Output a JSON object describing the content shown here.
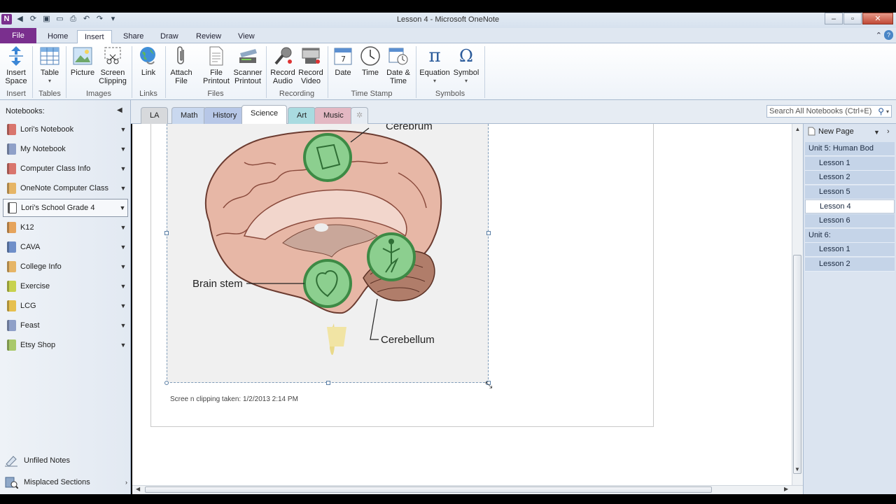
{
  "window": {
    "title": "Lesson 4  -  Microsoft OneNote"
  },
  "ribbon_tabs": [
    {
      "label": "File"
    },
    {
      "label": "Home"
    },
    {
      "label": "Insert"
    },
    {
      "label": "Share"
    },
    {
      "label": "Draw"
    },
    {
      "label": "Review"
    },
    {
      "label": "View"
    }
  ],
  "ribbon_buttons": {
    "insert_space": "Insert Space",
    "table": "Table",
    "picture": "Picture",
    "screen_clipping": "Screen Clipping",
    "link": "Link",
    "attach_file": "Attach File",
    "file_printout": "File Printout",
    "scanner_printout": "Scanner Printout",
    "record_audio": "Record Audio",
    "record_video": "Record Video",
    "date": "Date",
    "time": "Time",
    "date_time": "Date & Time",
    "equation": "Equation",
    "symbol": "Symbol"
  },
  "ribbon_groups": {
    "insert": "Insert",
    "tables": "Tables",
    "images": "Images",
    "links": "Links",
    "files": "Files",
    "recording": "Recording",
    "time_stamp": "Time Stamp",
    "symbols": "Symbols"
  },
  "notebooks": {
    "header": "Notebooks:",
    "items": [
      {
        "label": "Lori's Notebook",
        "color": "#d9756d"
      },
      {
        "label": "My Notebook",
        "color": "#8fa0c8"
      },
      {
        "label": "Computer Class Info",
        "color": "#d9756d"
      },
      {
        "label": "OneNote Computer Class",
        "color": "#e6b566"
      },
      {
        "label": "Lori's School Grade 4",
        "color": "#ffffff"
      },
      {
        "label": "K12",
        "color": "#e6a45c"
      },
      {
        "label": "CAVA",
        "color": "#6f8fc9"
      },
      {
        "label": "College Info",
        "color": "#e6b566"
      },
      {
        "label": "Exercise",
        "color": "#c8d24e"
      },
      {
        "label": "LCG",
        "color": "#e6c04e"
      },
      {
        "label": "Feast",
        "color": "#8fa0c8"
      },
      {
        "label": "Etsy Shop",
        "color": "#a9c96a"
      }
    ],
    "unfiled": "Unfiled Notes",
    "misplaced": "Misplaced Sections"
  },
  "section_tabs": [
    {
      "label": "LA",
      "color": "#d7d9dc"
    },
    {
      "label": "Math",
      "color": "#c9d8ef"
    },
    {
      "label": "History",
      "color": "#b7c7e7"
    },
    {
      "label": "Science",
      "color": "#ffffff"
    },
    {
      "label": "Art",
      "color": "#a9dbe0"
    },
    {
      "label": "Music",
      "color": "#e3b8c3"
    }
  ],
  "search": {
    "placeholder": "Search All Notebooks (Ctrl+E)"
  },
  "diagram": {
    "labels": [
      "Cerebrum",
      "Brain stem",
      "Cerebellum"
    ]
  },
  "caption": "Scree n clipping taken: 1/2/2013 2:14 PM",
  "pages": {
    "new_page": "New Page",
    "items": [
      {
        "label": "Unit 5: Human Bod",
        "level": "top"
      },
      {
        "label": "Lesson 1",
        "level": "sub"
      },
      {
        "label": "Lesson 2",
        "level": "sub"
      },
      {
        "label": "Lesson 5",
        "level": "sub"
      },
      {
        "label": "Lesson 4",
        "level": "sub",
        "current": true
      },
      {
        "label": "Lesson 6",
        "level": "sub"
      },
      {
        "label": "Unit 6:",
        "level": "top"
      },
      {
        "label": "Lesson 1",
        "level": "sub"
      },
      {
        "label": "Lesson 2",
        "level": "sub"
      }
    ]
  }
}
